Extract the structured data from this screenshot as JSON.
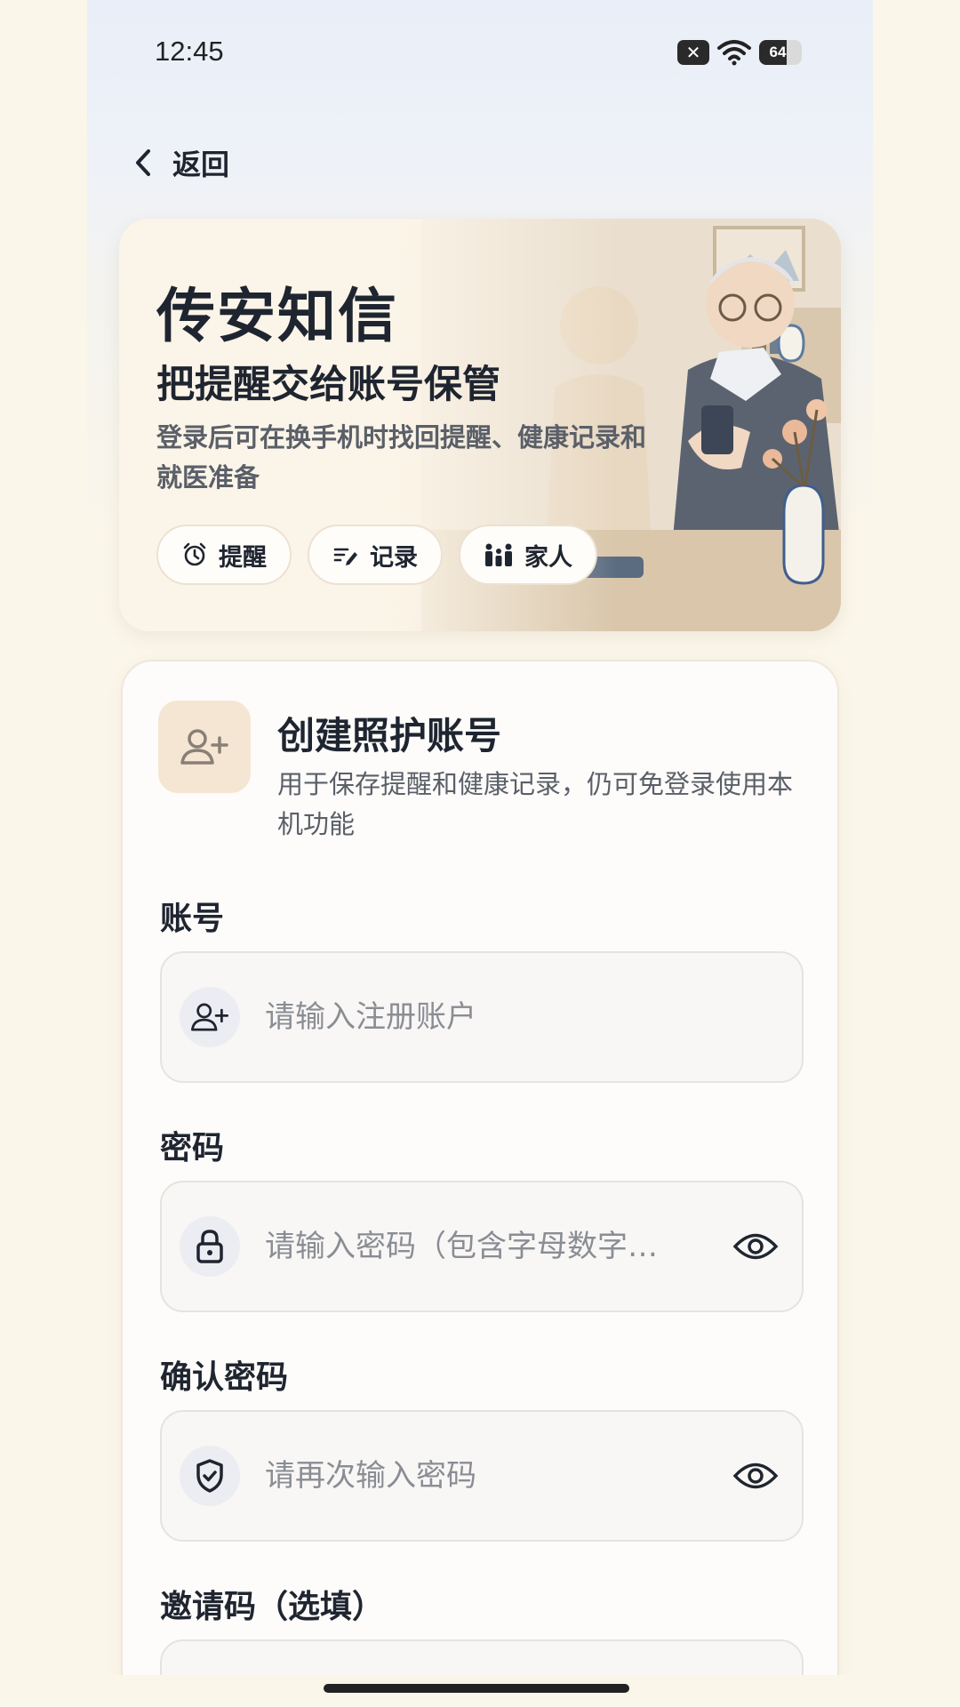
{
  "status_bar": {
    "time": "12:45",
    "battery": "64",
    "battery_level": 0.64
  },
  "nav": {
    "back_label": "返回"
  },
  "hero": {
    "title": "传安知信",
    "subtitle": "把提醒交给账号保管",
    "description": "登录后可在换手机时找回提醒、健康记录和就医准备",
    "chips": [
      {
        "icon": "alarm-clock-icon",
        "label": "提醒"
      },
      {
        "icon": "notes-edit-icon",
        "label": "记录"
      },
      {
        "icon": "family-icon",
        "label": "家人"
      }
    ]
  },
  "form": {
    "title": "创建照护账号",
    "description": "用于保存提醒和健康记录，仍可免登录使用本机功能",
    "fields": [
      {
        "label": "账号",
        "icon": "user-plus-icon",
        "placeholder": "请输入注册账户",
        "has_eye": false
      },
      {
        "label": "密码",
        "icon": "lock-icon",
        "placeholder": "请输入密码（包含字母数字…",
        "has_eye": true
      },
      {
        "label": "确认密码",
        "icon": "shield-check-icon",
        "placeholder": "请再次输入密码",
        "has_eye": true
      },
      {
        "label": "邀请码（选填）"
      }
    ]
  },
  "colors": {
    "accent_tint": "#f5e6d4",
    "text": "#1f2530",
    "muted": "#5a5f68"
  }
}
